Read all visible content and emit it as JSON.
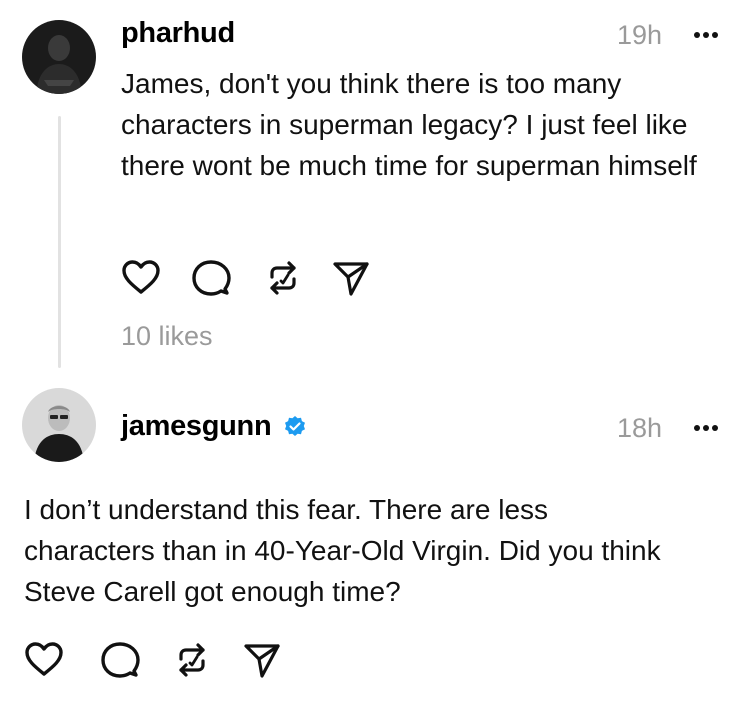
{
  "posts": [
    {
      "username": "pharhud",
      "timestamp": "19h",
      "text": "James, don't you think there is too many characters in superman legacy? I just feel like there wont be much time for superman himself",
      "likes": "10 likes"
    },
    {
      "username": "jamesgunn",
      "verified": true,
      "timestamp": "18h",
      "text": "I don’t understand this fear. There are less characters than in 40-Year-Old Virgin. Did you think Steve Carell got enough time?"
    }
  ],
  "icons": {
    "like": "heart-icon",
    "reply": "comment-icon",
    "repost": "repost-icon",
    "share": "share-icon",
    "more": "ellipsis-icon",
    "verified": "verified-badge-icon"
  },
  "colors": {
    "verified": "#1d9bf0",
    "muted_text": "#9a9a9a",
    "thread_line": "#e2e2e2"
  }
}
